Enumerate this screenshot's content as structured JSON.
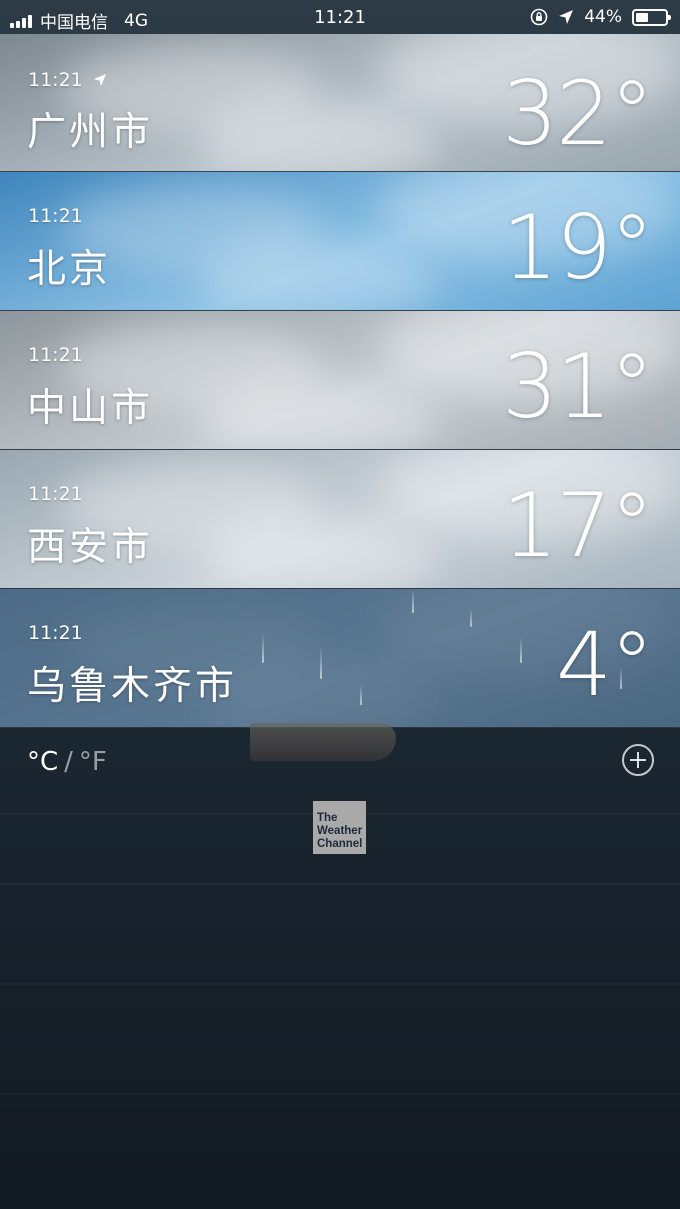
{
  "status_bar": {
    "carrier": "中国电信",
    "network": "4G",
    "time": "11:21",
    "battery_percent": "44%",
    "battery_level": 0.44,
    "icons": [
      "signal-icon",
      "rotation-lock-icon",
      "location-arrow-icon",
      "battery-icon"
    ]
  },
  "cities": [
    {
      "time": "11:21",
      "name": "广州市",
      "temp": "32°",
      "current_location": true,
      "bg": [
        "#7d8890",
        "#b8c3cb",
        "#9aa6ae"
      ]
    },
    {
      "time": "11:21",
      "name": "北京",
      "temp": "19°",
      "current_location": false,
      "bg": [
        "#3f86bd",
        "#8ec3e6",
        "#5ea3d3"
      ]
    },
    {
      "time": "11:21",
      "name": "中山市",
      "temp": "31°",
      "current_location": false,
      "bg": [
        "#8d969c",
        "#c7ced3",
        "#a4adb3"
      ]
    },
    {
      "time": "11:21",
      "name": "西安市",
      "temp": "17°",
      "current_location": false,
      "bg": [
        "#9ba8b2",
        "#cbd4da",
        "#a7b4be"
      ]
    },
    {
      "time": "11:21",
      "name": "乌鲁木齐市",
      "temp": "4°",
      "current_location": false,
      "bg": [
        "#4c6b86",
        "#5a7792",
        "#4a6780"
      ]
    }
  ],
  "footer": {
    "celsius_label": "°C",
    "separator": "/",
    "fahrenheit_label": "°F",
    "add_city_icon": "plus-circle-icon",
    "logo_lines": [
      "The",
      "Weather",
      "Channel"
    ]
  }
}
